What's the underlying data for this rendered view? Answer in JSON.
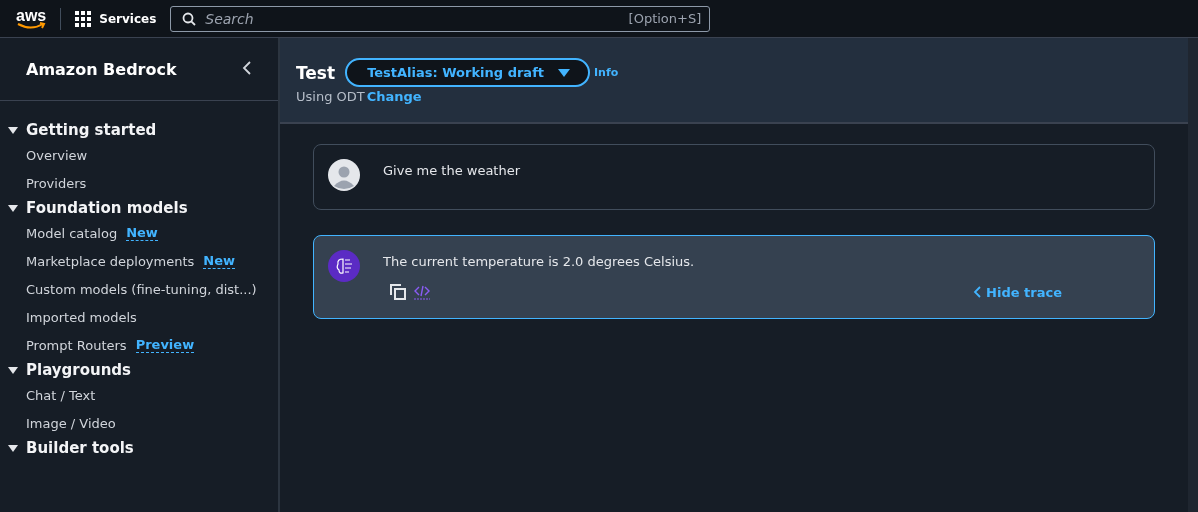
{
  "top_bar": {
    "logo": "aws",
    "services": "Services",
    "search": {
      "placeholder": "Search",
      "shortcut": "[Option+S]"
    }
  },
  "sidebar": {
    "title": "Amazon Bedrock",
    "sections": [
      {
        "label": "Getting started",
        "expanded": true,
        "items": [
          {
            "label": "Overview"
          },
          {
            "label": "Providers"
          }
        ]
      },
      {
        "label": "Foundation models",
        "expanded": true,
        "items": [
          {
            "label": "Model catalog",
            "badge": "New"
          },
          {
            "label": "Marketplace deployments",
            "badge": "New"
          },
          {
            "label": "Custom models (fine-tuning, dist...)"
          },
          {
            "label": "Imported models"
          },
          {
            "label": "Prompt Routers",
            "badge": "Preview"
          }
        ]
      },
      {
        "label": "Playgrounds",
        "expanded": true,
        "items": [
          {
            "label": "Chat / Text"
          },
          {
            "label": "Image / Video"
          }
        ]
      },
      {
        "label": "Builder tools",
        "expanded": true
      }
    ]
  },
  "header": {
    "title": "Test",
    "alias_select": "TestAlias: Working draft",
    "info": "Info",
    "using": "Using ODT",
    "change": "Change"
  },
  "messages": [
    {
      "kind": "user",
      "text": "Give me the weather",
      "selected": false
    },
    {
      "kind": "agent",
      "text": "The current temperature is 2.0 degrees Celsius.",
      "selected": true,
      "trace_button": "Hide trace"
    }
  ]
}
